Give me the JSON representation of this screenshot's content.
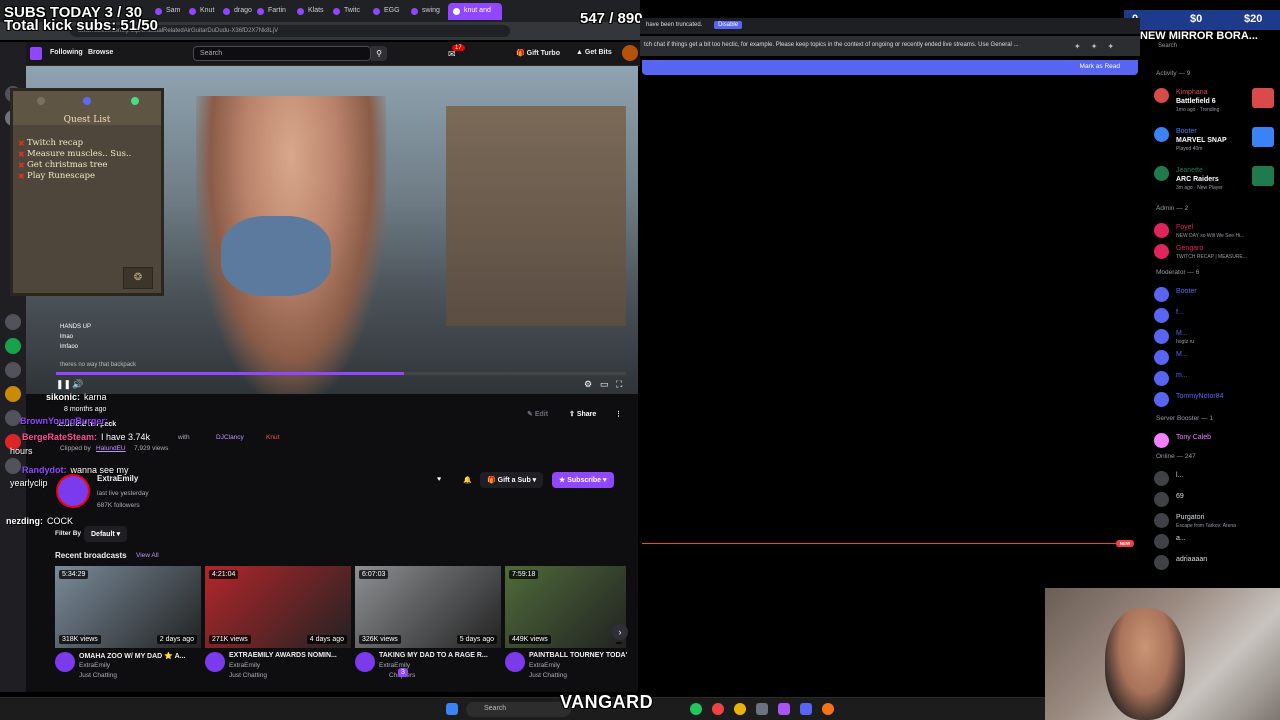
{
  "browser": {
    "tabs": [
      {
        "label": "Sam"
      },
      {
        "label": "Knut"
      },
      {
        "label": "drago"
      },
      {
        "label": "Fartin"
      },
      {
        "label": "Klats"
      },
      {
        "label": "Twitc"
      },
      {
        "label": "EGG"
      },
      {
        "label": "swing"
      },
      {
        "label": "knut and"
      }
    ],
    "url": "twitch.tv/extraemily/clip/UnusualRelatedAirGuitarDuDudu-X36fD2X7Nk8LjV"
  },
  "twitch_nav": {
    "following": "Following",
    "browse": "Browse",
    "search_placeholder": "Search",
    "notif_count": "17",
    "gift_turbo": "Gift Turbo",
    "get_bits": "Get Bits"
  },
  "overlay": {
    "subs_today": "SUBS TODAY 3 / 30",
    "kick_subs": "Total kick subs: 51/50",
    "counter": "547 / 890",
    "new_mirror": "NEW MIRROR BORA...",
    "cash_zero": "0",
    "cash_mid": "$0",
    "cash_goal": "$20",
    "vangard": "VANGARD"
  },
  "quest_list": {
    "title": "Quest List",
    "items": [
      "Twitch recap",
      "Measure muscles.. Sus..",
      "Get christmas tree",
      "Play Runescape"
    ]
  },
  "video": {
    "progress_fraction": 0.61,
    "overlay_chat": [
      "HANDS UP",
      "lmao",
      "lmfaoo",
      "theres no way that backpack"
    ]
  },
  "stream_chat": [
    {
      "user": "sikonic:",
      "text": "karna",
      "color": "#ffffff"
    },
    {
      "user": "",
      "text": "8 months ago",
      "color": "#ffffff"
    },
    {
      "user": "BrownYoungBurger:",
      "text": "",
      "color": "#9146ff"
    },
    {
      "user": "BergeRateSteam:",
      "text": "I have 3.74k",
      "color": "#ff4f9a"
    },
    {
      "user": "",
      "text": "hours",
      "color": "#ffffff"
    },
    {
      "user": "Randydot:",
      "text": "wanna see my",
      "color": "#9146ff"
    },
    {
      "user": "",
      "text": "yearlyclip",
      "color": "#ffffff"
    },
    {
      "user": "nezding:",
      "text": "COCK",
      "color": "#ffffff"
    }
  ],
  "clip_info": {
    "edit": "Edit",
    "share": "Share",
    "title": "knut and his pack",
    "with": "with",
    "with_user": "DJClancy",
    "with_user2": "Knut",
    "clipped_by": "Clipped by",
    "clipper": "HalundEU",
    "views": "7,929 views",
    "channel_name": "ExtraEmily",
    "last_live": "last live yesterday",
    "followers": "687K followers",
    "gift_sub": "Gift a Sub",
    "subscribe": "Subscribe",
    "filter_by": "Filter By",
    "filter_value": "Default",
    "recent_broadcasts": "Recent broadcasts",
    "view_all": "View All"
  },
  "broadcasts": [
    {
      "duration": "5:34:29",
      "views": "318K views",
      "ago": "2 days ago",
      "title": "OMAHA ZOO W/ MY DAD ⭐ A...",
      "channel": "ExtraEmily",
      "category": "Just Chatting",
      "color": "#7a8b9a"
    },
    {
      "duration": "4:21:04",
      "views": "271K views",
      "ago": "4 days ago",
      "title": "EXTRAEMILY AWARDS NOMIN...",
      "channel": "ExtraEmily",
      "category": "Just Chatting",
      "color": "#b3262b"
    },
    {
      "duration": "6:07:03",
      "views": "326K views",
      "ago": "5 days ago",
      "title": "TAKING MY DAD TO A RAGE R...",
      "channel": "ExtraEmily",
      "category": "Chapters",
      "color": "#8d8f92"
    },
    {
      "duration": "7:59:18",
      "views": "449K views",
      "ago": "",
      "title": "PAINTBALL TOURNEY TODA'",
      "channel": "ExtraEmily",
      "category": "Just Chatting",
      "color": "#4f6b3a"
    }
  ],
  "chapters_count": "3",
  "discord": {
    "truncated": "have been truncated.",
    "disable": "Disable",
    "topic": "tch chat if things get a bit too hectic, for example. Please keep topics in the context of ongoing or recently ended live streams. Use General ...",
    "mark_as_read": "Mark as Read",
    "new_label": "NEW",
    "search": "Search"
  },
  "members": {
    "activity_header": "Activity — 9",
    "activity": [
      {
        "name": "Kimphana",
        "game": "Battlefield 6",
        "sub": "1mo ago · Trending",
        "color": "#d94a4a"
      },
      {
        "name": "Booter",
        "game": "MARVEL SNAP",
        "sub": "Played 40m",
        "color": "#3b82f6"
      },
      {
        "name": "Jeanette",
        "game": "ARC Raiders",
        "sub": "3m ago · New Player",
        "color": "#1f7a4d"
      }
    ],
    "admin_header": "Admin — 2",
    "admin": [
      {
        "name": "Foyel",
        "sub": "NEW DAY so Will We See Hi...",
        "color": "#e0245e"
      },
      {
        "name": "Gengaro",
        "sub": "TWITCH RECAP | MEASURE...",
        "color": "#e0245e"
      }
    ],
    "moderator_header": "Moderator — 6",
    "moderators": [
      {
        "name": "Booter",
        "sub": "",
        "color": "#5865f2"
      },
      {
        "name": "f...",
        "sub": "",
        "color": "#5865f2"
      },
      {
        "name": "M...",
        "sub": "hogtz.ru",
        "color": "#5865f2"
      },
      {
        "name": "M...",
        "sub": "",
        "color": "#5865f2"
      },
      {
        "name": "m...",
        "sub": "",
        "color": "#5865f2"
      },
      {
        "name": "TommyNotor84",
        "sub": "",
        "color": "#5865f2"
      }
    ],
    "booster_header": "Server Booster — 1",
    "boosters": [
      {
        "name": "Tony Caleb",
        "sub": "",
        "color": "#f47fff"
      }
    ],
    "online_header": "Online — 247",
    "online": [
      {
        "name": "l...",
        "sub": "",
        "color": "#dbdee1"
      },
      {
        "name": "69",
        "sub": "",
        "color": "#dbdee1"
      },
      {
        "name": "Purgatori",
        "sub": "Escape from Tarkov: Arena",
        "color": "#dbdee1"
      },
      {
        "name": "a...",
        "sub": "",
        "color": "#dbdee1"
      },
      {
        "name": "adriaaaan",
        "sub": "",
        "color": "#dbdee1"
      }
    ]
  },
  "taskbar": {
    "search": "Search"
  }
}
